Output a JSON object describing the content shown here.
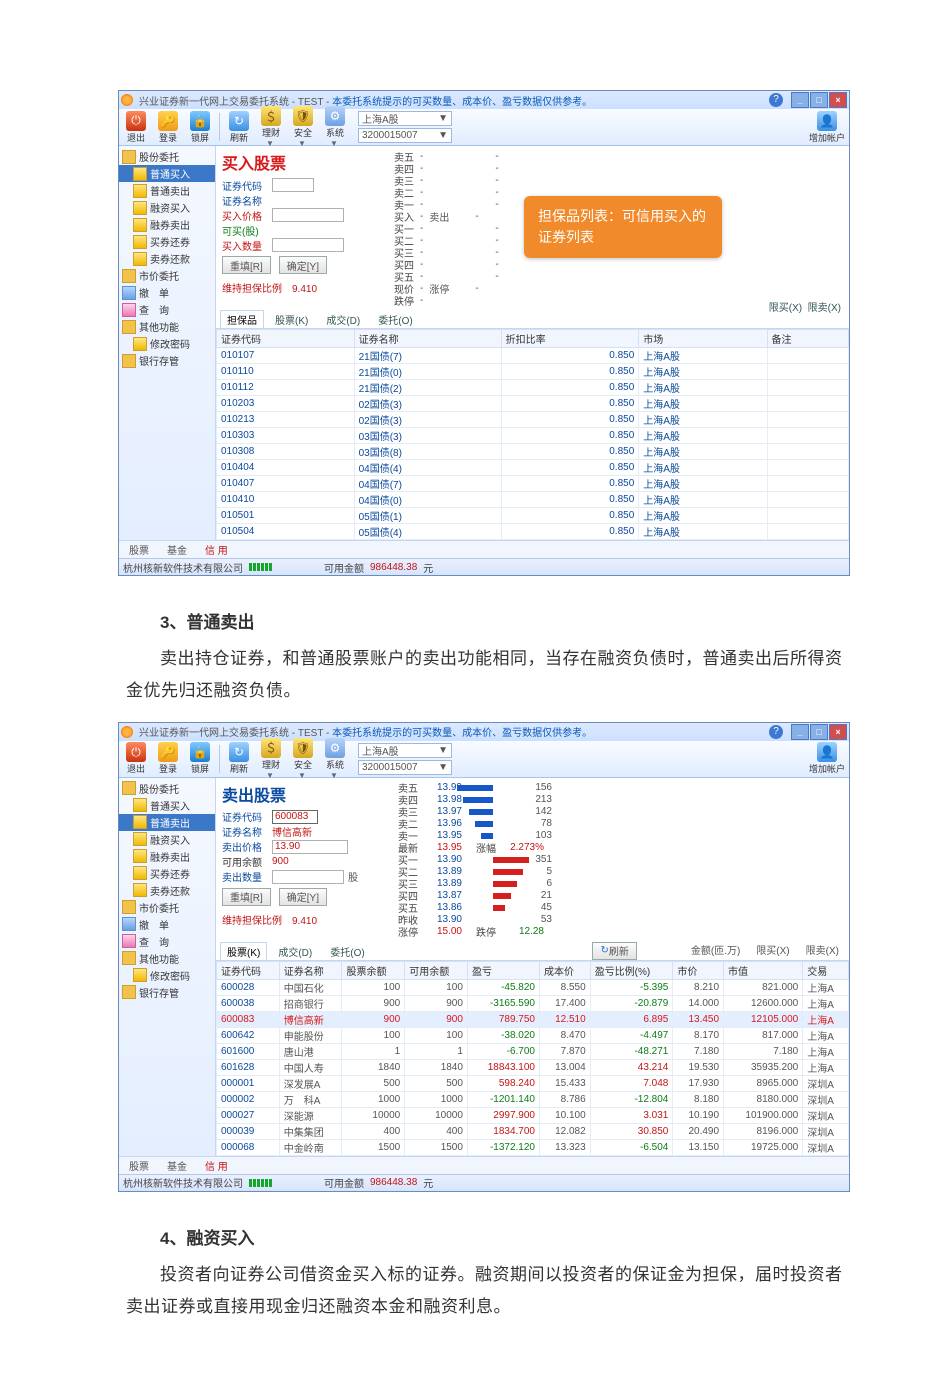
{
  "titlebar_text_1": "兴业证券新一代网上交易委托系统 - TEST - ",
  "titlebar_text_2": "本委托系统提示的可买数量、成本价、盈亏数据仅供参考。",
  "window_help": "?",
  "toolbar": {
    "exit": "退出",
    "login": "登录",
    "lock": "锁屏",
    "refresh": "刷新",
    "money": "理财",
    "safe": "安全",
    "sys": "系统",
    "add": "增加帐户"
  },
  "account_selector": {
    "market": "上海A股",
    "acct": "3200015007"
  },
  "sidebar": {
    "root": "股份委托",
    "items": [
      {
        "label": "普通买入",
        "sel": [
          true,
          false
        ]
      },
      {
        "label": "普通卖出",
        "sel": [
          false,
          true
        ]
      },
      {
        "label": "融资买入"
      },
      {
        "label": "融券卖出"
      },
      {
        "label": "买券还券"
      },
      {
        "label": "卖券还款"
      }
    ],
    "others": [
      "市价委托",
      "撤　单",
      "查　询",
      "其他功能",
      "修改密码",
      "银行存管"
    ]
  },
  "app1": {
    "form_title": "买入股票",
    "rows": {
      "code_label": "证券代码",
      "code": "",
      "name_label": "证券名称",
      "name": "",
      "price_label": "买入价格",
      "price": "",
      "maxqty_label": "可买(股)",
      "maxqty": "",
      "qty_label": "买入数量",
      "qty": ""
    },
    "btn_reset": "重填[R]",
    "btn_ok": "确定[Y]",
    "ratio_label": "维持担保比例",
    "ratio": "9.410",
    "quote_labels": [
      "卖五",
      "卖四",
      "卖三",
      "卖二",
      "卖一",
      "买入",
      "卖出",
      "买一",
      "买二",
      "买三",
      "买四",
      "买五",
      "现价",
      "涨停",
      "跌停"
    ],
    "tabs": [
      "担保品",
      "股票(K)",
      "成交(D)",
      "委托(O)"
    ],
    "hidden_tabs": [
      "限买(X)",
      "限卖(X)"
    ],
    "table": {
      "headers": [
        "证券代码",
        "证券名称",
        "折扣比率",
        "市场",
        "备注"
      ],
      "rows": [
        [
          "010107",
          "21国债(7)",
          "0.850",
          "上海A股",
          ""
        ],
        [
          "010110",
          "21国债(0)",
          "0.850",
          "上海A股",
          ""
        ],
        [
          "010112",
          "21国债(2)",
          "0.850",
          "上海A股",
          ""
        ],
        [
          "010203",
          "02国债(3)",
          "0.850",
          "上海A股",
          ""
        ],
        [
          "010213",
          "02国债(3)",
          "0.850",
          "上海A股",
          ""
        ],
        [
          "010303",
          "03国债(3)",
          "0.850",
          "上海A股",
          ""
        ],
        [
          "010308",
          "03国债(8)",
          "0.850",
          "上海A股",
          ""
        ],
        [
          "010404",
          "04国债(4)",
          "0.850",
          "上海A股",
          ""
        ],
        [
          "010407",
          "04国债(7)",
          "0.850",
          "上海A股",
          ""
        ],
        [
          "010410",
          "04国债(0)",
          "0.850",
          "上海A股",
          ""
        ],
        [
          "010501",
          "05国债(1)",
          "0.850",
          "上海A股",
          ""
        ],
        [
          "010504",
          "05国债(4)",
          "0.850",
          "上海A股",
          ""
        ]
      ]
    },
    "callout": "担保品列表：可信用买入的证券列表"
  },
  "app2": {
    "form_title": "卖出股票",
    "rows": {
      "code_label": "证券代码",
      "code": "600083",
      "name_label": "证券名称",
      "name": "博信高新",
      "price_label": "卖出价格",
      "price": "13.90",
      "avail_label": "可用余额",
      "avail": "900",
      "qty_label": "卖出数量",
      "qty": "",
      "unit": "股"
    },
    "btn_reset": "重填[R]",
    "btn_ok": "确定[Y]",
    "ratio_label": "维持担保比例",
    "ratio": "9.410",
    "quotes": {
      "sell": [
        {
          "l": "卖五",
          "p": "13.99",
          "v": "156"
        },
        {
          "l": "卖四",
          "p": "13.98",
          "v": "213"
        },
        {
          "l": "卖三",
          "p": "13.97",
          "v": "142"
        },
        {
          "l": "卖二",
          "p": "13.96",
          "v": "78"
        },
        {
          "l": "卖一",
          "p": "13.95",
          "v": "103"
        }
      ],
      "latest": {
        "l": "最新",
        "p": "13.95",
        "chg_l": "涨幅",
        "chg": "2.273%"
      },
      "buy": [
        {
          "l": "买一",
          "p": "13.90",
          "v": "351"
        },
        {
          "l": "买二",
          "p": "13.89",
          "v": "5"
        },
        {
          "l": "买三",
          "p": "13.89",
          "v": "6"
        },
        {
          "l": "买四",
          "p": "13.87",
          "v": "21"
        },
        {
          "l": "买五",
          "p": "13.86",
          "v": "45"
        }
      ],
      "close": {
        "l": "昨收",
        "p": "13.90",
        "v": "53"
      },
      "limitup": {
        "l": "涨停",
        "p": "15.00",
        "dl": "跌停",
        "dv": "12.28"
      }
    },
    "tabs": [
      "股票(K)",
      "成交(D)",
      "委托(O)"
    ],
    "refresh_btn": "刷新",
    "filter": {
      "amount_label": "金额(匝.万)",
      "buyin_label": "限买(X)",
      "sellout_label": "限卖(X)"
    },
    "table": {
      "headers": [
        "证券代码",
        "证券名称",
        "股票余额",
        "可用余额",
        "盈亏",
        "成本价",
        "盈亏比例(%)",
        "市价",
        "市值",
        "交易"
      ],
      "rows": [
        {
          "code": "600028",
          "name": "中国石化",
          "bal": "100",
          "avail": "100",
          "pl": "-45.820",
          "cost": "8.550",
          "plp": "-5.395",
          "price": "8.210",
          "mv": "821.000",
          "mkt": "上海A"
        },
        {
          "code": "600038",
          "name": "招商银行",
          "bal": "900",
          "avail": "900",
          "pl": "-3165.590",
          "cost": "17.400",
          "plp": "-20.879",
          "price": "14.000",
          "mv": "12600.000",
          "mkt": "上海A"
        },
        {
          "code": "600083",
          "name": "博信高新",
          "bal": "900",
          "avail": "900",
          "pl": "789.750",
          "cost": "12.510",
          "plp": "6.895",
          "price": "13.450",
          "mv": "12105.000",
          "mkt": "上海A",
          "sel": true
        },
        {
          "code": "600642",
          "name": "申能股份",
          "bal": "100",
          "avail": "100",
          "pl": "-38.020",
          "cost": "8.470",
          "plp": "-4.497",
          "price": "8.170",
          "mv": "817.000",
          "mkt": "上海A"
        },
        {
          "code": "601600",
          "name": "唐山港",
          "bal": "1",
          "avail": "1",
          "pl": "-6.700",
          "cost": "7.870",
          "plp": "-48.271",
          "price": "7.180",
          "mv": "7.180",
          "mkt": "上海A"
        },
        {
          "code": "601628",
          "name": "中国人寿",
          "bal": "1840",
          "avail": "1840",
          "pl": "18843.100",
          "cost": "13.004",
          "plp": "43.214",
          "price": "19.530",
          "mv": "35935.200",
          "mkt": "上海A"
        },
        {
          "code": "000001",
          "name": "深发展A",
          "bal": "500",
          "avail": "500",
          "pl": "598.240",
          "cost": "15.433",
          "plp": "7.048",
          "price": "17.930",
          "mv": "8965.000",
          "mkt": "深圳A"
        },
        {
          "code": "000002",
          "name": "万　科A",
          "bal": "1000",
          "avail": "1000",
          "pl": "-1201.140",
          "cost": "8.786",
          "plp": "-12.804",
          "price": "8.180",
          "mv": "8180.000",
          "mkt": "深圳A"
        },
        {
          "code": "000027",
          "name": "深能源",
          "bal": "10000",
          "avail": "10000",
          "pl": "2997.900",
          "cost": "10.100",
          "plp": "3.031",
          "price": "10.190",
          "mv": "101900.000",
          "mkt": "深圳A"
        },
        {
          "code": "000039",
          "name": "中集集团",
          "bal": "400",
          "avail": "400",
          "pl": "1834.700",
          "cost": "12.082",
          "plp": "30.850",
          "price": "20.490",
          "mv": "8196.000",
          "mkt": "深圳A"
        },
        {
          "code": "000068",
          "name": "中金岭南",
          "bal": "1500",
          "avail": "1500",
          "pl": "-1372.120",
          "cost": "13.323",
          "plp": "-6.504",
          "price": "13.150",
          "mv": "19725.000",
          "mkt": "深圳A"
        }
      ]
    }
  },
  "bottom_tabs": [
    "股票",
    "基金",
    "信 用"
  ],
  "statusbar": {
    "company": "杭州核新软件技术有限公司",
    "avail_label": "可用金额",
    "avail_value": "986448.38",
    "unit": "元"
  },
  "doc": {
    "sec3_head": "3、普通卖出",
    "sec3_text": "卖出持仓证券，和普通股票账户的卖出功能相同，当存在融资负债时，普通卖出后所得资金优先归还融资负债。",
    "sec4_head": "4、融资买入",
    "sec4_text": "投资者向证券公司借资金买入标的证券。融资期间以投资者的保证金为担保，届时投资者卖出证券或直接用现金归还融资本金和融资利息。"
  }
}
